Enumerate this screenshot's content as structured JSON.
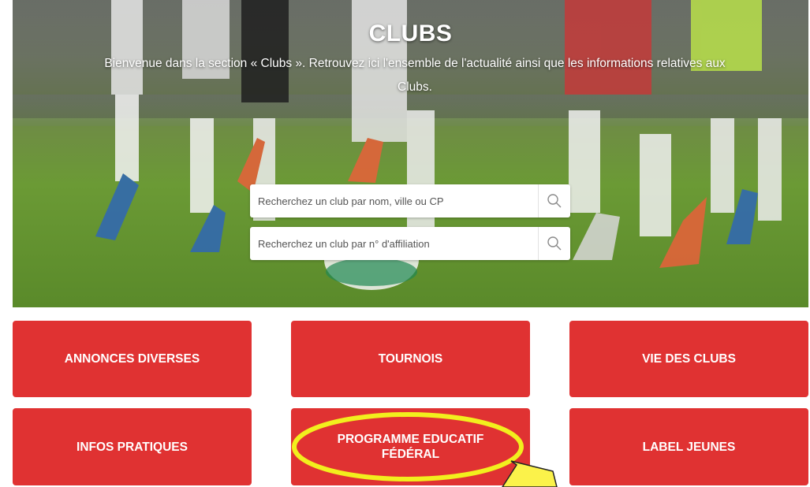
{
  "hero": {
    "title": "CLUBS",
    "subtitle": "Bienvenue dans la section « Clubs ». Retrouvez ici l'ensemble de l'actualité ainsi que les informations relatives aux Clubs."
  },
  "search": {
    "by_name_placeholder": "Recherchez un club par nom, ville ou CP",
    "by_affiliation_placeholder": "Recherchez un club par n° d'affiliation"
  },
  "tiles": {
    "annonces": "ANNONCES DIVERSES",
    "tournois": "TOURNOIS",
    "vie_clubs": "VIE DES CLUBS",
    "infos": "INFOS PRATIQUES",
    "programme_line1": "PROGRAMME EDUCATIF",
    "programme_line2": "FÉDÉRAL",
    "label": "LABEL JEUNES"
  },
  "colors": {
    "tile_red": "#e03232",
    "highlight_yellow": "#f2ef1d",
    "arrow_yellow": "#fbf24a"
  },
  "icons": {
    "search": "magnifier-icon",
    "annotation_ellipse": "highlight-ellipse",
    "annotation_arrow": "pointer-arrow"
  }
}
